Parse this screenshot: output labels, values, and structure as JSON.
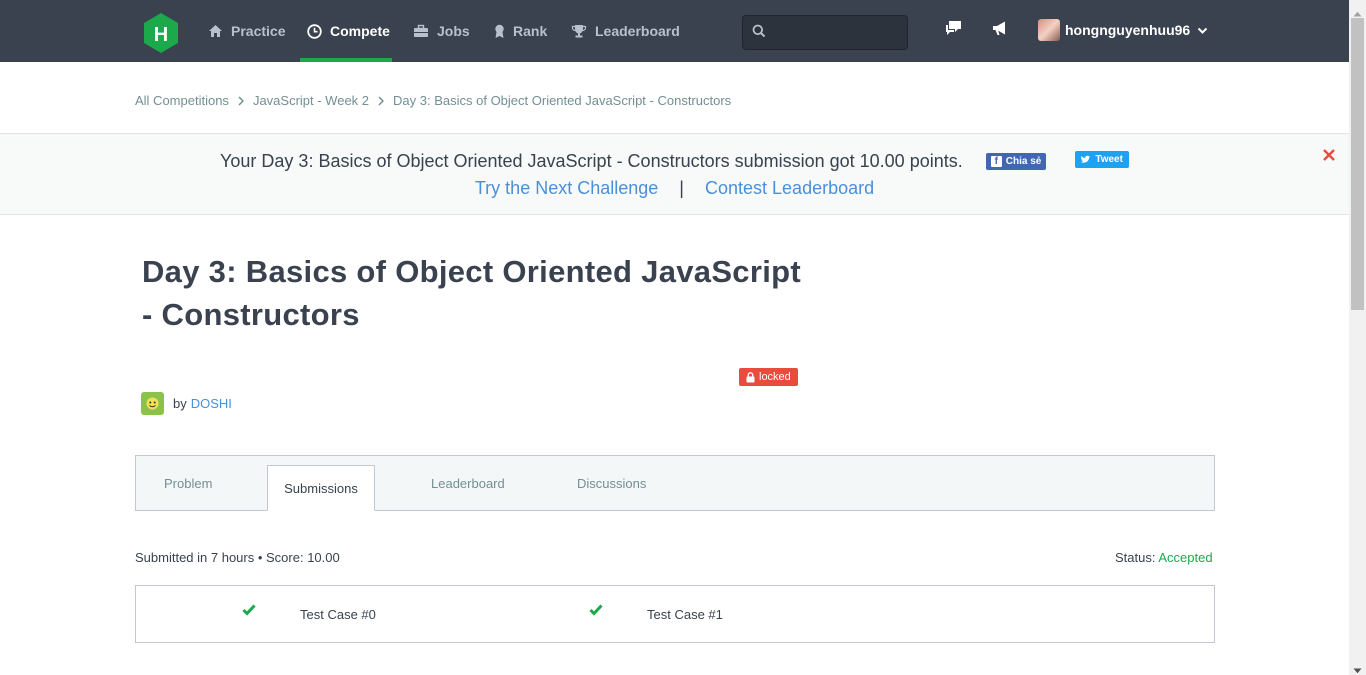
{
  "nav": {
    "items": [
      {
        "label": "Practice",
        "icon": "home-icon"
      },
      {
        "label": "Compete",
        "icon": "clock-icon",
        "active": true
      },
      {
        "label": "Jobs",
        "icon": "briefcase-icon"
      },
      {
        "label": "Rank",
        "icon": "ribbon-icon"
      },
      {
        "label": "Leaderboard",
        "icon": "trophy-icon"
      }
    ],
    "search_value": "",
    "username": "hongnguyenhuu96"
  },
  "breadcrumb": [
    "All Competitions",
    "JavaScript - Week 2",
    "Day 3: Basics of Object Oriented JavaScript - Constructors"
  ],
  "banner": {
    "message": "Your Day 3: Basics of Object Oriented JavaScript - Constructors submission got 10.00 points.",
    "share_label": "Chia sẻ",
    "tweet_label": "Tweet",
    "next_challenge": "Try the Next Challenge",
    "separator": "|",
    "contest_leaderboard": "Contest Leaderboard"
  },
  "challenge": {
    "title_line1": "Day 3: Basics of Object Oriented JavaScript",
    "title_line2": "- Constructors",
    "locked_label": "locked",
    "by": "by",
    "author": "DOSHI"
  },
  "tabs": [
    "Problem",
    "Submissions",
    "Leaderboard",
    "Discussions"
  ],
  "submission": {
    "info": "Submitted in 7 hours • Score: 10.00",
    "status_label": "Status:",
    "status_value": "Accepted",
    "test_cases": [
      "Test Case #0",
      "Test Case #1"
    ]
  },
  "colors": {
    "nav_bg": "#39424e",
    "accent_green": "#1ba94c",
    "link_blue": "#4a90d9",
    "locked_red": "#e74c3c"
  }
}
